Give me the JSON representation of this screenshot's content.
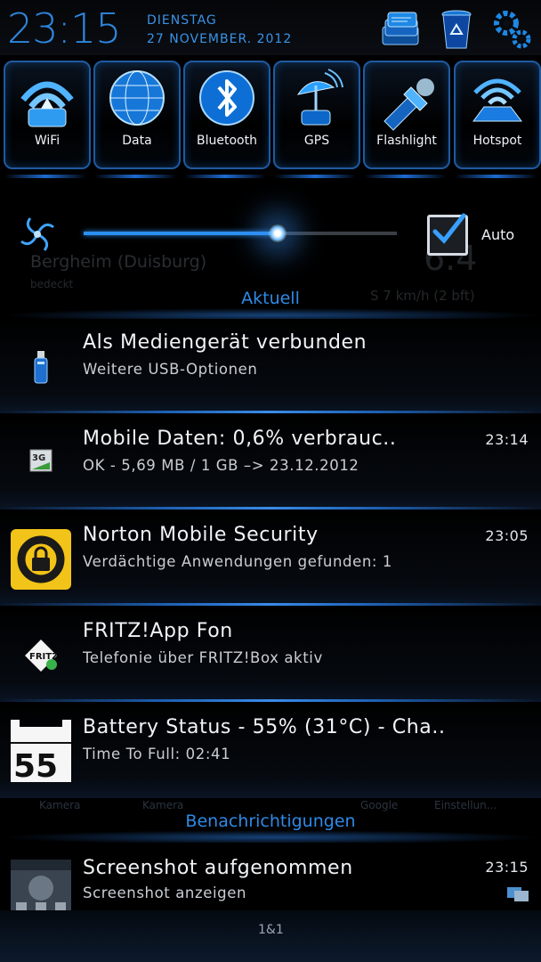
{
  "header": {
    "time": "23:15",
    "day": "DIENSTAG",
    "date": "27 NOVEMBER. 2012",
    "icons": [
      "notification-stack-icon",
      "recycle-bin-icon",
      "settings-gears-icon"
    ]
  },
  "toggles": [
    {
      "label": "WiFi",
      "icon": "wifi-icon"
    },
    {
      "label": "Data",
      "icon": "globe-icon"
    },
    {
      "label": "Bluetooth",
      "icon": "bluetooth-icon"
    },
    {
      "label": "GPS",
      "icon": "satellite-icon"
    },
    {
      "label": "Flashlight",
      "icon": "flashlight-icon"
    },
    {
      "label": "Hotspot",
      "icon": "hotspot-icon"
    }
  ],
  "brightness": {
    "level": 0.62,
    "auto_label": "Auto",
    "auto_checked": true
  },
  "weather": {
    "city": "Bergheim (Duisburg)",
    "condition": "bedeckt",
    "temp": "6.4",
    "wind": "S 7 km/h (2 bft)"
  },
  "sections": {
    "current": "Aktuell",
    "notifications": "Benachrichtigungen"
  },
  "notifications": [
    {
      "title": "Als Mediengerät verbunden",
      "subtitle": "Weitere USB-Optionen",
      "time": "",
      "icon": "usb-icon"
    },
    {
      "title": "Mobile Daten: 0,6% verbrauc..",
      "subtitle": "OK - 5,69 MB / 1 GB –> 23.12.2012",
      "time": "23:14",
      "icon": "3g-icon"
    },
    {
      "title": "Norton Mobile Security",
      "subtitle": "Verdächtige Anwendungen gefunden: 1",
      "time": "23:05",
      "icon": "norton-lock-icon"
    },
    {
      "title": "FRITZ!App Fon",
      "subtitle": "Telefonie über FRITZ!Box aktiv",
      "time": "",
      "icon": "fritz-icon",
      "icon_text": "FRITZ!"
    },
    {
      "title": "Battery Status - 55% (31°C) - Cha..",
      "subtitle": "Time To Full: 02:41",
      "time": "",
      "icon": "battery-55-icon",
      "icon_text": "55"
    },
    {
      "title": "Screenshot aufgenommen",
      "subtitle": "Screenshot anzeigen",
      "time": "23:15",
      "icon": "screenshot-thumbnail-icon"
    }
  ],
  "ghost_labels": [
    "Kamera",
    "Kamera",
    "Google",
    "Einstellun..."
  ],
  "carrier": "1&1",
  "colors": {
    "accent": "#2e86de",
    "norton": "#f2c318",
    "background": "#000000"
  }
}
